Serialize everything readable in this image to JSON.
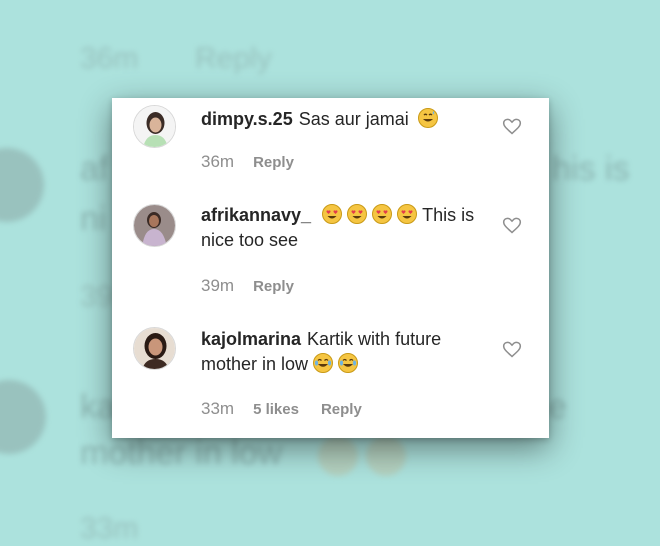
{
  "background": {
    "color": "#ace2dd",
    "ghost_texts": [
      "36m",
      "Reply",
      "af",
      "his is",
      "ni",
      "39",
      "ka",
      "e",
      "mother in low",
      "33m"
    ]
  },
  "comments": [
    {
      "username": "dimpy.s.25",
      "text": "Sas aur jamai",
      "emojis": [
        "grinning-sweat-emoji"
      ],
      "time": "36m",
      "likes": "",
      "reply_label": "Reply"
    },
    {
      "username": "afrikannavy_",
      "text": "This is nice too see",
      "emojis": [
        "heart-eyes-emoji",
        "heart-eyes-emoji",
        "heart-eyes-emoji",
        "heart-eyes-emoji"
      ],
      "time": "39m",
      "likes": "",
      "reply_label": "Reply"
    },
    {
      "username": "kajolmarina",
      "text": "Kartik with future mother in low",
      "emojis": [
        "tears-of-joy-emoji",
        "tears-of-joy-emoji"
      ],
      "time": "33m",
      "likes": "5 likes",
      "reply_label": "Reply"
    }
  ],
  "colors": {
    "card_bg": "#ffffff",
    "text": "#262626",
    "muted": "#8e8e8e",
    "emoji_yellow": "#f5c542"
  }
}
